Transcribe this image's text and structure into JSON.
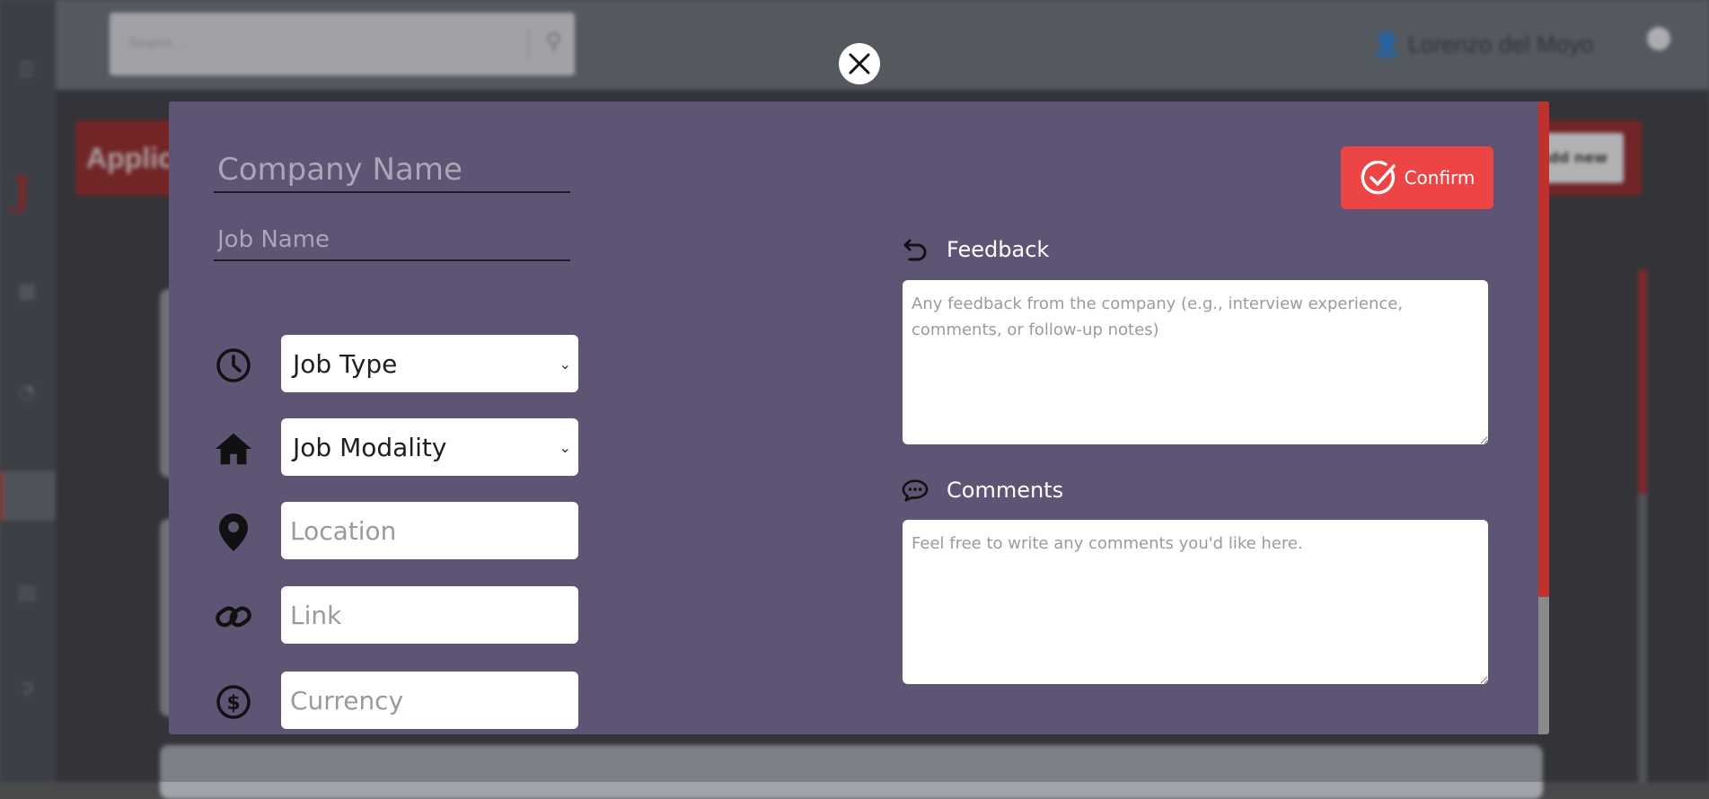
{
  "background": {
    "search_placeholder": "Search...",
    "user_name": "Lorenzo del Moyo",
    "banner_title": "Applic",
    "add_button_label": "Add new"
  },
  "modal": {
    "company_name_placeholder": "Company Name",
    "job_name_placeholder": "Job Name",
    "job_type_label": "Job Type",
    "job_modality_label": "Job Modality",
    "location_placeholder": "Location",
    "link_placeholder": "Link",
    "currency_placeholder": "Currency",
    "confirm_label": "Confirm",
    "feedback_label": "Feedback",
    "feedback_placeholder": "Any feedback from the company (e.g., interview experience, comments, or follow-up notes)",
    "comments_label": "Comments",
    "comments_placeholder": "Feel free to write any comments you'd like here.",
    "accent_color": "#ed4546",
    "modal_background": "#5d5573"
  }
}
